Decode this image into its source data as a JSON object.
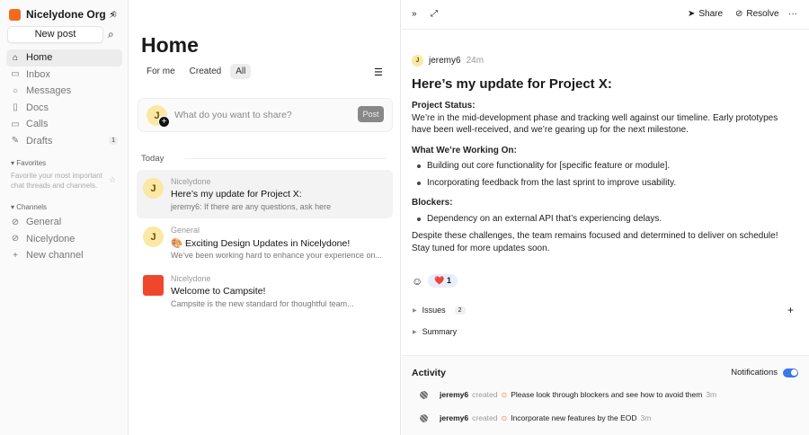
{
  "sidebar": {
    "org": "Nicelydone Org",
    "new_post": "New post",
    "nav": [
      {
        "label": "Home",
        "icon": "home-icon"
      },
      {
        "label": "Inbox",
        "icon": "inbox-icon"
      },
      {
        "label": "Messages",
        "icon": "message-icon"
      },
      {
        "label": "Docs",
        "icon": "doc-icon"
      },
      {
        "label": "Calls",
        "icon": "video-icon"
      },
      {
        "label": "Drafts",
        "icon": "draft-icon",
        "badge": "1"
      }
    ],
    "favorites": "Favorites",
    "favorites_hint": "Favorite your most important chat threads and channels.",
    "channels_heading": "Channels",
    "channels": [
      "General",
      "Nicelydone"
    ],
    "new_channel": "New channel"
  },
  "home": {
    "title": "Home",
    "tabs": [
      "For me",
      "Created",
      "All"
    ],
    "composer_placeholder": "What do you want to share?",
    "composer_avatar": "J",
    "post": "Post",
    "today": "Today",
    "feed": [
      {
        "channel": "Nicelydone",
        "title": "Here’s my update for Project X:",
        "snippet": "jeremy6: If there are any questions, ask here",
        "avatar": "J"
      },
      {
        "channel": "General",
        "title": "🎨 Exciting Design Updates in Nicelydone!",
        "snippet": "We’ve been working hard to enhance your experience on...",
        "avatar": "J"
      },
      {
        "channel": "Nicelydone",
        "title": "Welcome to Campsite!",
        "snippet": "Campsite is the new standard for thoughtful team..."
      }
    ]
  },
  "detail": {
    "share": "Share",
    "resolve": "Resolve",
    "author": "jeremy6",
    "avatar": "J",
    "time": "24m",
    "title": "Here’s my update for Project X:",
    "status_heading": "Project Status:",
    "status_text": "We’re in the mid-development phase and tracking well against our timeline. Early prototypes have been well-received, and we’re gearing up for the next milestone.",
    "working_heading": "What We’re Working On:",
    "working_items": [
      "Building out core functionality for [specific feature or module].",
      "Incorporating feedback from the last sprint to improve usability."
    ],
    "blockers_heading": "Blockers:",
    "blockers_items": [
      "Dependency on an external API that’s experiencing delays."
    ],
    "closing": "Despite these challenges, the team remains focused and determined to deliver on schedule! Stay tuned for more updates soon.",
    "reaction_emoji": "❤️",
    "reaction_count": "1",
    "issues": "Issues",
    "issues_count": "2",
    "summary": "Summary"
  },
  "activity": {
    "title": "Activity",
    "notifications": "Notifications",
    "notifications_on": true,
    "items": [
      {
        "user": "jeremy6",
        "verb": "created",
        "text": "Please look through blockers and see how to avoid them",
        "time": "3m"
      },
      {
        "user": "jeremy6",
        "verb": "created",
        "text": "Incorporate new features by the EOD",
        "time": "3m"
      }
    ]
  }
}
